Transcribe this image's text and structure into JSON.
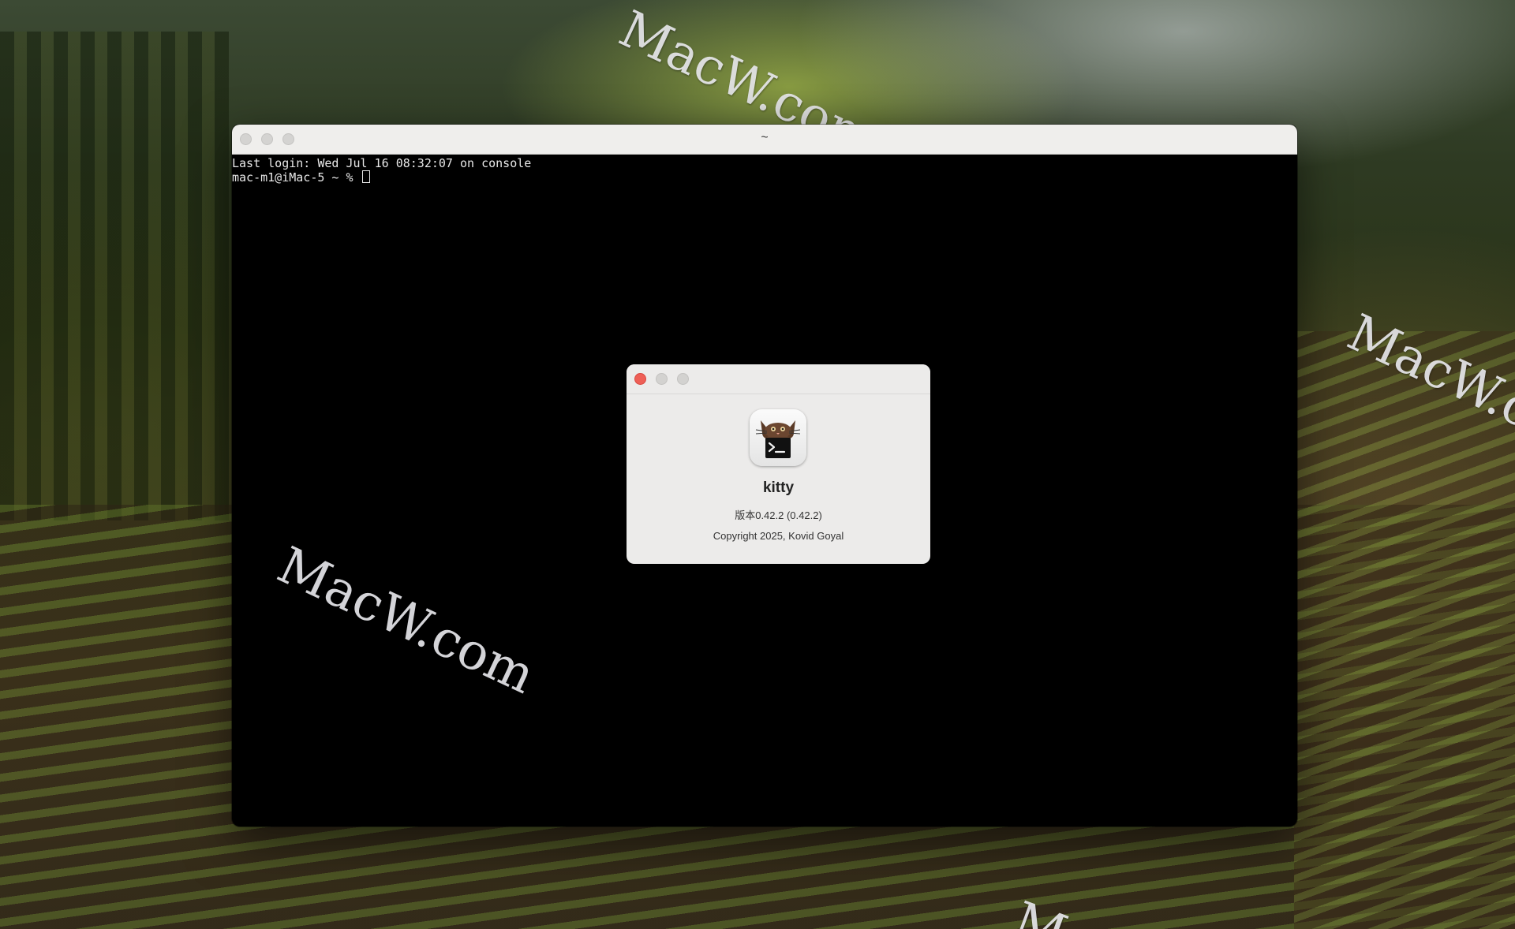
{
  "desktop": {
    "watermark": "MacW.com",
    "watermark_partial_bottom": "M"
  },
  "terminal": {
    "title": "~",
    "lines": [
      "Last login: Wed Jul 16 08:32:07 on console",
      "mac-m1@iMac-5 ~ % "
    ]
  },
  "about": {
    "app_name": "kitty",
    "version": "版本0.42.2 (0.42.2)",
    "copyright": "Copyright 2025, Kovid Goyal",
    "icon": "kitty-cat-terminal-icon"
  },
  "colors": {
    "close_button": "#ee5f56",
    "dialog_background": "#ecebea",
    "terminal_background": "#000000",
    "terminal_text": "#e8e8e8"
  }
}
